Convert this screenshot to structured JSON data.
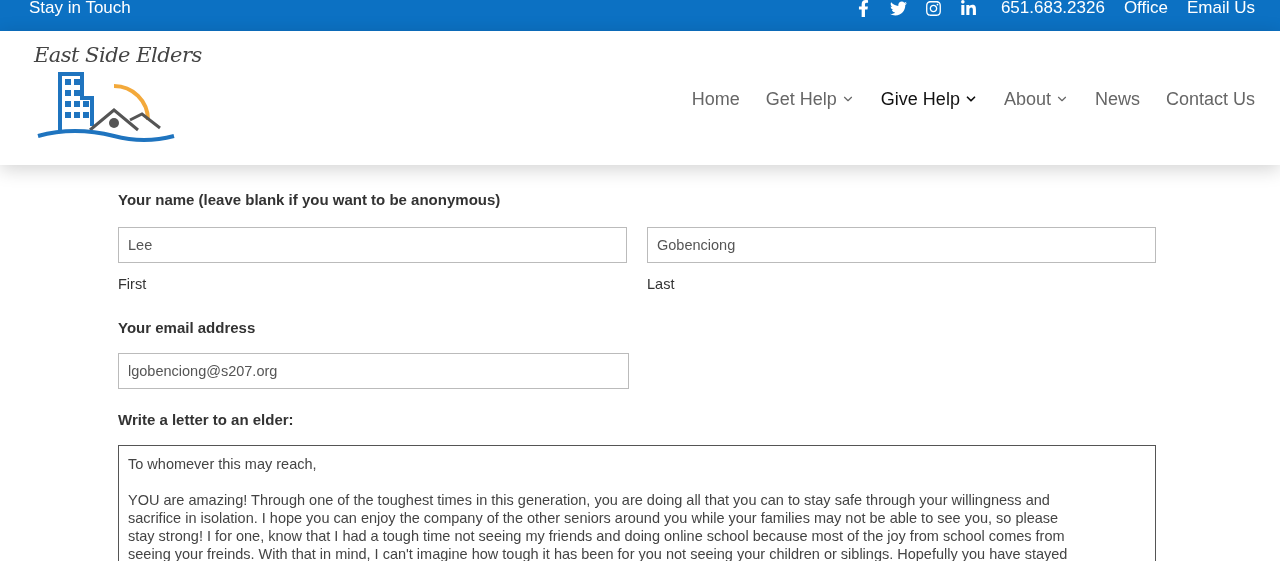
{
  "top_bar": {
    "title": "Stay in Touch",
    "social": [
      {
        "kind": "facebook"
      },
      {
        "kind": "twitter"
      },
      {
        "kind": "instagram"
      },
      {
        "kind": "linkedin"
      }
    ],
    "links": [
      "651.683.2326",
      "Office",
      "Email Us"
    ]
  },
  "logo": {
    "text": "East Side Elders"
  },
  "nav": [
    {
      "label": "Home",
      "selected": false,
      "dropdown": false
    },
    {
      "label": "Get Help",
      "selected": false,
      "dropdown": true
    },
    {
      "label": "Give Help",
      "selected": true,
      "dropdown": true
    },
    {
      "label": "About",
      "selected": false,
      "dropdown": true
    },
    {
      "label": "News",
      "selected": false,
      "dropdown": false
    },
    {
      "label": "Contact Us",
      "selected": false,
      "dropdown": false
    }
  ],
  "form": {
    "name": {
      "label": "Your name (leave blank if you want to be anonymous)",
      "first": {
        "value": "Lee",
        "sublabel": "First"
      },
      "last": {
        "value": "Gobenciong",
        "sublabel": "Last"
      }
    },
    "email": {
      "label": "Your email address",
      "value": "lgobenciong@s207.org"
    },
    "letter": {
      "label": "Write a letter to an elder:",
      "paragraphs": [
        [
          "To whomever this may reach,"
        ],
        [
          "YOU are amazing! Through one of the toughest times in this generation, you are doing all that you can to stay safe through your willingness and",
          "sacrifice in isolation. I hope you can enjoy the company of the other seniors around you while your families may not be able to see you, so please",
          "stay strong! I for one, know that I had a tough time not seeing my friends and doing online school because most of the joy from school comes from",
          "seeing your freinds. With that in mind, I can't imagine how tough it has been for you not seeing your children or siblings. Hopefully you have stayed"
        ]
      ]
    }
  }
}
